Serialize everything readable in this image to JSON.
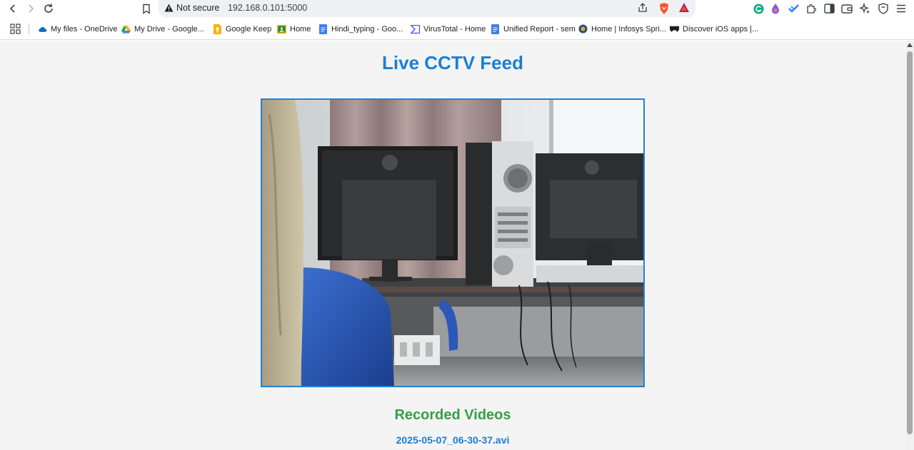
{
  "browser": {
    "security_label": "Not secure",
    "url": "192.168.0.101:5000",
    "bookmarks": [
      {
        "label": "My files - OneDrive",
        "icon": "onedrive-icon",
        "color": "#0f6cbd"
      },
      {
        "label": "My Drive - Google...",
        "icon": "google-drive-icon",
        "color": "#1ea362"
      },
      {
        "label": "Google Keep",
        "icon": "google-keep-icon",
        "color": "#f6b400"
      },
      {
        "label": "Home",
        "icon": "classroom-icon",
        "color": "#1f8a3b"
      },
      {
        "label": "Hindi_typing - Goo...",
        "icon": "google-docs-icon",
        "color": "#3f7ee8"
      },
      {
        "label": "VirusTotal - Home",
        "icon": "virustotal-icon",
        "color": "#394eff"
      },
      {
        "label": "Unified Report - sem",
        "icon": "google-docs-icon",
        "color": "#3f7ee8"
      },
      {
        "label": "Home | Infosys Spri...",
        "icon": "infosys-icon",
        "color": "#1d4f91"
      },
      {
        "label": "Discover iOS apps |...",
        "icon": "apps-gamepad-icon",
        "color": "#1f1f1f"
      }
    ]
  },
  "page": {
    "title": "Live CCTV Feed",
    "feed_alt": "Live camera frame",
    "recorded_title": "Recorded Videos",
    "recordings": [
      "2025-05-07_06-30-37.avi"
    ]
  },
  "colors": {
    "title_blue": "#1a7fd4",
    "recorded_green": "#34a043",
    "page_bg": "#f4f4f5"
  }
}
